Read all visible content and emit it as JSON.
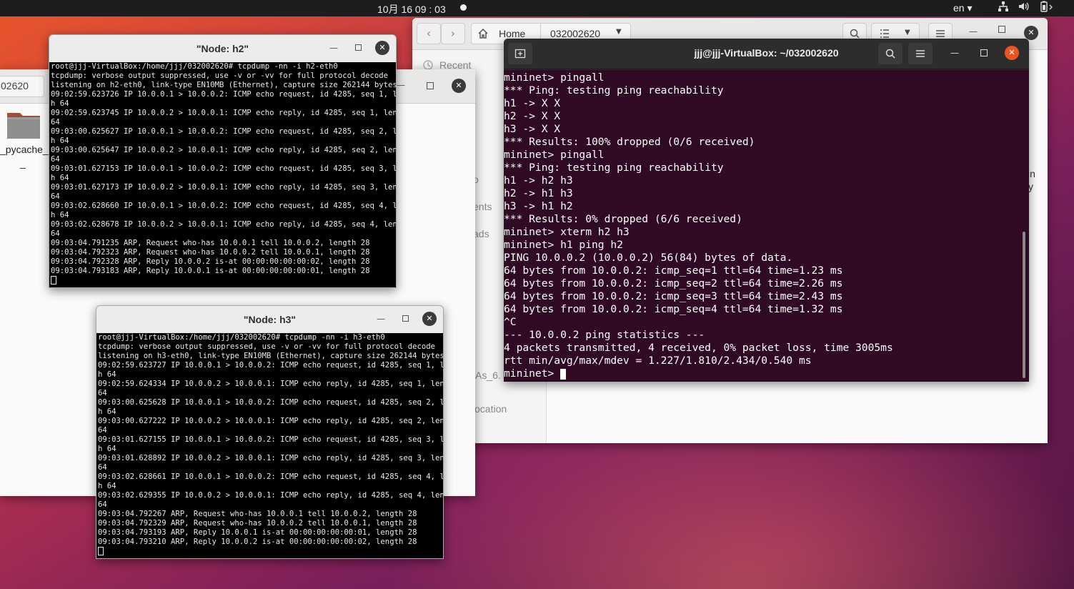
{
  "topbar": {
    "datetime": "10月 16  09 : 03",
    "lang": "en ▾",
    "icons": [
      "network-icon",
      "volume-icon",
      "battery-icon"
    ]
  },
  "files_window": {
    "path_home": "Home",
    "path_folder": "032002620",
    "sidebar": [
      "Recent",
      "o",
      "ents",
      "ads",
      "As_6.",
      "ocation"
    ],
    "right_text": [
      "in",
      "y"
    ]
  },
  "bg_files_window": {
    "path": "02620",
    "folder_name": "_pycache_",
    "folder_name_2": "_"
  },
  "node_h2": {
    "title": "\"Node: h2\"",
    "lines": [
      "root@jjj-VirtualBox:/home/jjj/032002620# tcpdump -nn -i h2-eth0",
      "tcpdump: verbose output suppressed, use -v or -vv for full protocol decode",
      "listening on h2-eth0, link-type EN10MB (Ethernet), capture size 262144 bytes",
      "09:02:59.623726 IP 10.0.0.1 > 10.0.0.2: ICMP echo request, id 4285, seq 1, lengt",
      "h 64",
      "09:02:59.623745 IP 10.0.0.2 > 10.0.0.1: ICMP echo reply, id 4285, seq 1, length",
      "64",
      "09:03:00.625627 IP 10.0.0.1 > 10.0.0.2: ICMP echo request, id 4285, seq 2, lengt",
      "h 64",
      "09:03:00.625647 IP 10.0.0.2 > 10.0.0.1: ICMP echo reply, id 4285, seq 2, length",
      "64",
      "09:03:01.627153 IP 10.0.0.1 > 10.0.0.2: ICMP echo request, id 4285, seq 3, lengt",
      "h 64",
      "09:03:01.627173 IP 10.0.0.2 > 10.0.0.1: ICMP echo reply, id 4285, seq 3, length",
      "64",
      "09:03:02.628660 IP 10.0.0.1 > 10.0.0.2: ICMP echo request, id 4285, seq 4, lengt",
      "h 64",
      "09:03:02.628678 IP 10.0.0.2 > 10.0.0.1: ICMP echo reply, id 4285, seq 4, length",
      "64",
      "09:03:04.791235 ARP, Request who-has 10.0.0.1 tell 10.0.0.2, length 28",
      "09:03:04.792323 ARP, Request who-has 10.0.0.2 tell 10.0.0.1, length 28",
      "09:03:04.792328 ARP, Reply 10.0.0.2 is-at 00:00:00:00:00:02, length 28",
      "09:03:04.793183 ARP, Reply 10.0.0.1 is-at 00:00:00:00:00:01, length 28",
      ""
    ]
  },
  "node_h3": {
    "title": "\"Node: h3\"",
    "lines": [
      "root@jjj-VirtualBox:/home/jjj/032002620# tcpdump -nn -i h3-eth0",
      "tcpdump: verbose output suppressed, use -v or -vv for full protocol decode",
      "listening on h3-eth0, link-type EN10MB (Ethernet), capture size 262144 bytes",
      "09:02:59.623727 IP 10.0.0.1 > 10.0.0.2: ICMP echo request, id 4285, seq 1, lengt",
      "h 64",
      "09:02:59.624334 IP 10.0.0.2 > 10.0.0.1: ICMP echo reply, id 4285, seq 1, length",
      "64",
      "09:03:00.625628 IP 10.0.0.1 > 10.0.0.2: ICMP echo request, id 4285, seq 2, lengt",
      "h 64",
      "09:03:00.627222 IP 10.0.0.2 > 10.0.0.1: ICMP echo reply, id 4285, seq 2, length",
      "64",
      "09:03:01.627155 IP 10.0.0.1 > 10.0.0.2: ICMP echo request, id 4285, seq 3, lengt",
      "h 64",
      "09:03:01.628892 IP 10.0.0.2 > 10.0.0.1: ICMP echo reply, id 4285, seq 3, length",
      "64",
      "09:03:02.628661 IP 10.0.0.1 > 10.0.0.2: ICMP echo request, id 4285, seq 4, lengt",
      "h 64",
      "09:03:02.629355 IP 10.0.0.2 > 10.0.0.1: ICMP echo reply, id 4285, seq 4, length",
      "64",
      "09:03:04.792267 ARP, Request who-has 10.0.0.1 tell 10.0.0.2, length 28",
      "09:03:04.792329 ARP, Request who-has 10.0.0.2 tell 10.0.0.1, length 28",
      "09:03:04.793193 ARP, Reply 10.0.0.1 is-at 00:00:00:00:00:01, length 28",
      "09:03:04.793210 ARP, Reply 10.0.0.2 is-at 00:00:00:00:00:02, length 28",
      ""
    ]
  },
  "terminal": {
    "title": "jjj@jjj-VirtualBox: ~/032002620",
    "lines": [
      "mininet> pingall",
      "*** Ping: testing ping reachability",
      "h1 -> X X",
      "h2 -> X X",
      "h3 -> X X",
      "*** Results: 100% dropped (0/6 received)",
      "mininet> pingall",
      "*** Ping: testing ping reachability",
      "h1 -> h2 h3",
      "h2 -> h1 h3",
      "h3 -> h1 h2",
      "*** Results: 0% dropped (6/6 received)",
      "mininet> xterm h2 h3",
      "mininet> h1 ping h2",
      "PING 10.0.0.2 (10.0.0.2) 56(84) bytes of data.",
      "64 bytes from 10.0.0.2: icmp_seq=1 ttl=64 time=1.23 ms",
      "64 bytes from 10.0.0.2: icmp_seq=2 ttl=64 time=2.26 ms",
      "64 bytes from 10.0.0.2: icmp_seq=3 ttl=64 time=2.43 ms",
      "64 bytes from 10.0.0.2: icmp_seq=4 ttl=64 time=1.32 ms",
      "^C",
      "--- 10.0.0.2 ping statistics ---",
      "4 packets transmitted, 4 received, 0% packet loss, time 3005ms",
      "rtt min/avg/max/mdev = 1.227/1.810/2.434/0.540 ms",
      "mininet> "
    ]
  }
}
